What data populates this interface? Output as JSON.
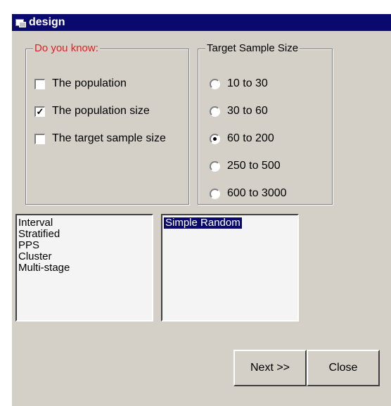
{
  "window": {
    "title": "design"
  },
  "know_group": {
    "legend": "Do you know:",
    "options": [
      {
        "label": "The population",
        "checked": false
      },
      {
        "label": "The population size",
        "checked": true
      },
      {
        "label": "The target sample size",
        "checked": false
      }
    ]
  },
  "sample_group": {
    "legend": "Target Sample Size",
    "options": [
      {
        "label": "10 to 30",
        "selected": false
      },
      {
        "label": "30 to 60",
        "selected": false
      },
      {
        "label": "60 to 200",
        "selected": true
      },
      {
        "label": "250 to 500",
        "selected": false
      },
      {
        "label": "600 to 3000",
        "selected": false
      }
    ]
  },
  "available_list": [
    "Interval",
    "Stratified",
    "PPS",
    "Cluster",
    "Multi-stage"
  ],
  "selected_list": [
    "Simple Random"
  ],
  "buttons": {
    "next": "Next >>",
    "close": "Close"
  },
  "colors": {
    "title_bar": "#0a0a6e",
    "legend_highlight": "#e02020",
    "dialog_bg": "#d4d0c8"
  },
  "icons": {
    "title": "window-app-icon"
  }
}
